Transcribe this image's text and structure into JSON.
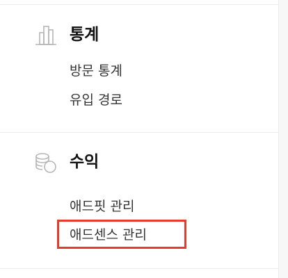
{
  "colors": {
    "highlight": "#e53b2c",
    "divider": "#ededed",
    "icon": "#b5b5b5"
  },
  "sections": [
    {
      "icon": "bar-chart-icon",
      "title": "통계",
      "items": [
        {
          "label": "방문 통계"
        },
        {
          "label": "유입 경로"
        }
      ]
    },
    {
      "icon": "coins-icon",
      "title": "수익",
      "items": [
        {
          "label": "애드핏 관리"
        },
        {
          "label": "애드센스 관리",
          "highlighted": true
        }
      ]
    }
  ]
}
